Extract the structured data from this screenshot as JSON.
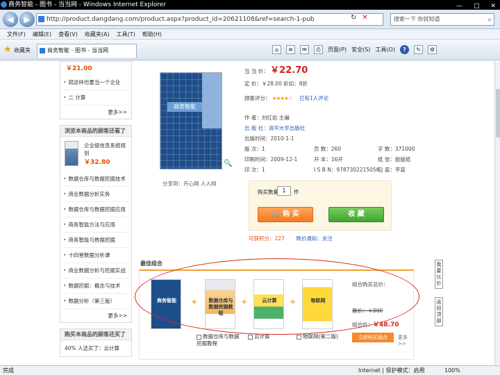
{
  "window": {
    "title": "商务智能 - 图书 - 当当网 - Windows Internet Explorer",
    "buttons": [
      "—",
      "□",
      "✕"
    ]
  },
  "address_bar": {
    "back": "◀",
    "forward": "▶",
    "url": "http://product.dangdang.com/product.aspx?product_id=20621108&ref=search-1-pub",
    "refresh": "↻",
    "stop": "✕",
    "search_placeholder": "搜索一下 你就知道",
    "search_icon": "search-icon"
  },
  "menu": {
    "items": [
      "文件(F)",
      "编辑(E)",
      "查看(V)",
      "收藏夹(A)",
      "工具(T)",
      "帮助(H)"
    ]
  },
  "favorites_bar": {
    "label": "收藏夹",
    "tab_title": "商务智能 - 图书 - 当当网",
    "commands": {
      "page": "页面(P)",
      "safety": "安全(S)",
      "tools": "工具(O)",
      "help": "?"
    }
  },
  "left_sidebar": {
    "top_price": "￥21.00",
    "top_items": [
      "就这样也要当一个企业",
      "二 计算"
    ],
    "more": "更多>>",
    "box2_title": "浏览本商品的顾客还看了",
    "box2_product": {
      "title": "企业级信息系统规划",
      "price": "￥32.80"
    },
    "box2_items": [
      "数据仓库与数据挖掘技术",
      "商业数据分析实务",
      "数据仓库与数据挖掘应用",
      "商务智能方法与应用",
      "商务智能与数据挖掘",
      "十四堂数据分析课",
      "商业数据分析与挖掘实战",
      "数据挖掘：概念与技术",
      "数据分析（第三版）"
    ],
    "box3_title": "购买本商品的顾客还买了",
    "box3_first": "40% 人还买了：云计算"
  },
  "product": {
    "cover_title": "商务智能",
    "share_text": "分享到：开心网  人人网",
    "price_label": "当 当 价：",
    "price": "￥22.70",
    "market_price": "定    价：￥28.00    折扣：8折",
    "rating_label": "顾客评分：",
    "stars": "★★★★☆",
    "review_link": "已有1人评论",
    "meta": {
      "author": "作    者：刘红岩  主编",
      "publisher": "出 版 社：清华大学出版社",
      "pub_date": "出版时间：2010-1-1",
      "edition": "版    次：1",
      "pages": "页    数：260",
      "words": "字    数：371000",
      "print_date": "印刷时间：2009-12-1",
      "format": "开    本：16开",
      "paper": "纸    张：胶版纸",
      "print_count": "印    次：1",
      "isbn": "I S B N：9787302215056",
      "binding": "包    装：平装"
    },
    "qty_label": "购买数量：",
    "qty_value": "1",
    "qty_unit": "件",
    "buy_label": "购 买",
    "fav_label": "收 藏",
    "points_text": "可获积分：227",
    "other_text": "降价通知：关注"
  },
  "bundle": {
    "title": "最佳组合",
    "items": [
      {
        "cover": "商务智能",
        "label": ""
      },
      {
        "cover": "数据仓库与数据挖掘教程",
        "label": "数据仓库与数据挖掘教程"
      },
      {
        "cover": "云计算",
        "label": "云计算"
      },
      {
        "cover": "物联网",
        "label": "物联网(第二版)"
      }
    ],
    "plus": "+",
    "info_title": "组合购买总价：",
    "orig": "原价：￥000",
    "price_label": "组合价：",
    "price_value": "￥48.70",
    "buy": "立即购买组合",
    "more": "更多>>"
  },
  "side_tabs": {
    "compare": "我要比价",
    "back": "返回顶部"
  },
  "status_bar": {
    "done": "完成",
    "zone": "Internet | 保护模式：启用",
    "zoom": "100%"
  }
}
